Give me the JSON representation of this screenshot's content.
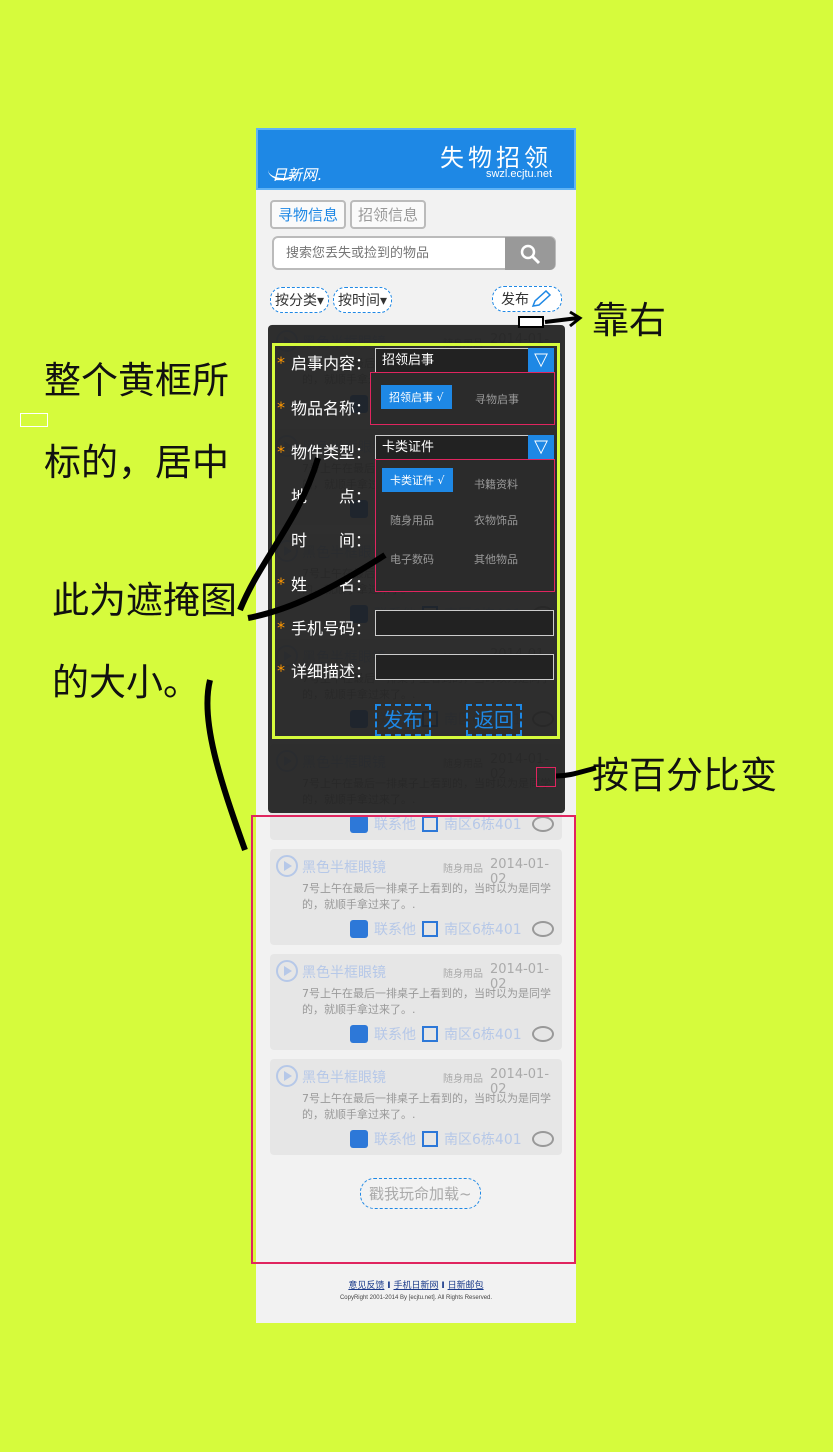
{
  "header": {
    "logo": "日新网.",
    "title": "失物招领",
    "url": "swzl.ecjtu.net"
  },
  "tabs": [
    {
      "label": "寻物信息"
    },
    {
      "label": "招领信息"
    }
  ],
  "search": {
    "placeholder": "搜索您丢失或捡到的物品"
  },
  "filters": {
    "by_category": "按分类▾",
    "by_time": "按时间▾",
    "publish": "发布"
  },
  "item": {
    "title": "黑色半框眼镜",
    "category": "随身用品",
    "date": "2014-01-02",
    "desc": "7号上午在最后一排桌子上看到的，当时以为是同学的，就顺手拿过来了。.",
    "contact": "联系他",
    "location": "南区6栋401"
  },
  "load_more": "戳我玩命加载~",
  "footer": {
    "links": [
      "意见反馈",
      "手机日新网",
      "日新邮包"
    ],
    "separator": "I",
    "copyright": "CopyRight 2001-2014 By [ecjtu.net]. All Rights Reserved."
  },
  "modal": {
    "rows": [
      {
        "star": "*",
        "label": "启事内容："
      },
      {
        "star": "*",
        "label": "物品名称："
      },
      {
        "star": "*",
        "label": "物件类型："
      },
      {
        "star": "",
        "label": "地　　点："
      },
      {
        "star": "",
        "label": "时　　间："
      },
      {
        "star": "*",
        "label": "姓　　名："
      },
      {
        "star": "*",
        "label": "手机号码："
      },
      {
        "star": "*",
        "label": "详细描述："
      }
    ],
    "notice_value": "招领启事",
    "type_value": "卡类证件",
    "notice_options": [
      "招领启事 √",
      "寻物启事"
    ],
    "type_options": [
      "卡类证件 √",
      "书籍资料",
      "随身用品",
      "衣物饰品",
      "电子数码",
      "其他物品"
    ],
    "submit": "发布",
    "back": "返回"
  },
  "annotations": {
    "right": "靠右",
    "center_1": "整个黄框所",
    "center_2": "标的，居中",
    "mask_1": "此为遮掩图",
    "mask_2": "的大小。",
    "percent": "按百分比变"
  },
  "colors": {
    "background": "#d6fb3c",
    "brand": "#1e88e5",
    "frame_yellow": "#d6fb3c",
    "frame_red": "#e0255f"
  }
}
